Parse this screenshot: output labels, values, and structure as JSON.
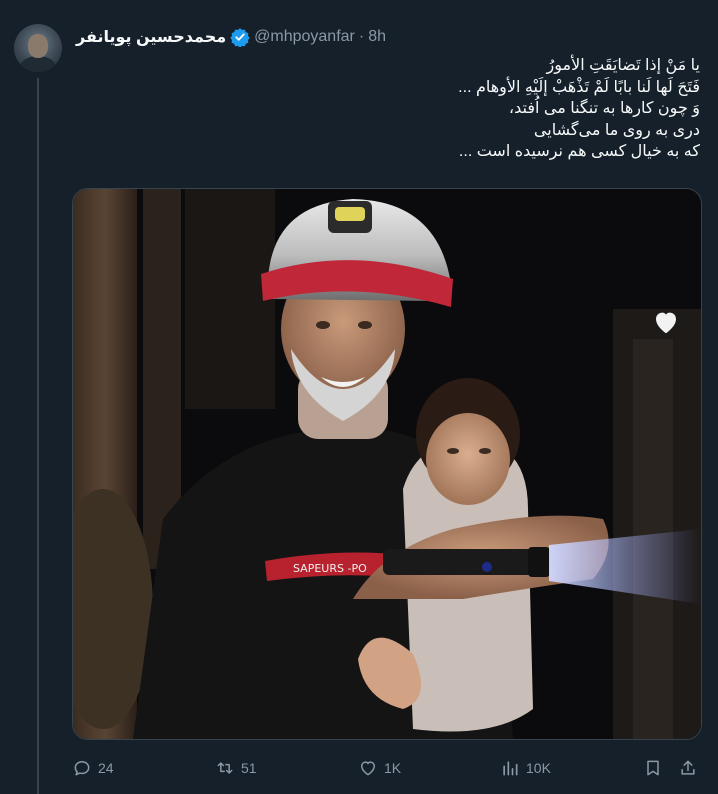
{
  "author": {
    "display_name": "محمدحسین پویانفر",
    "handle": "@mhpoyanfar",
    "separator": "·",
    "time": "8h"
  },
  "tweet": {
    "lines": [
      "یا مَنْ إذا تَضایَقَتِ الأمورُ",
      "فَتَحَ لَها لَنا بابًا لَمْ تَذْهَبْ إلَیْهِ الأوهام ...",
      "وَ چون کارها به تنگنا می اُفتد،",
      "دری به روی ما می‌گشایی",
      "که به خیال کسی هم نرسیده است ..."
    ]
  },
  "media": {
    "overlay_icon": "heart-icon",
    "uniform_text": "SAPEURS -PO"
  },
  "actions": {
    "replies": "24",
    "reposts": "51",
    "likes": "1K",
    "views": "10K"
  },
  "colors": {
    "background": "#15202b",
    "text": "#f7f9f9",
    "muted": "#8b98a5",
    "verified": "#1d9bf0",
    "helmet_red": "#c0283a"
  }
}
